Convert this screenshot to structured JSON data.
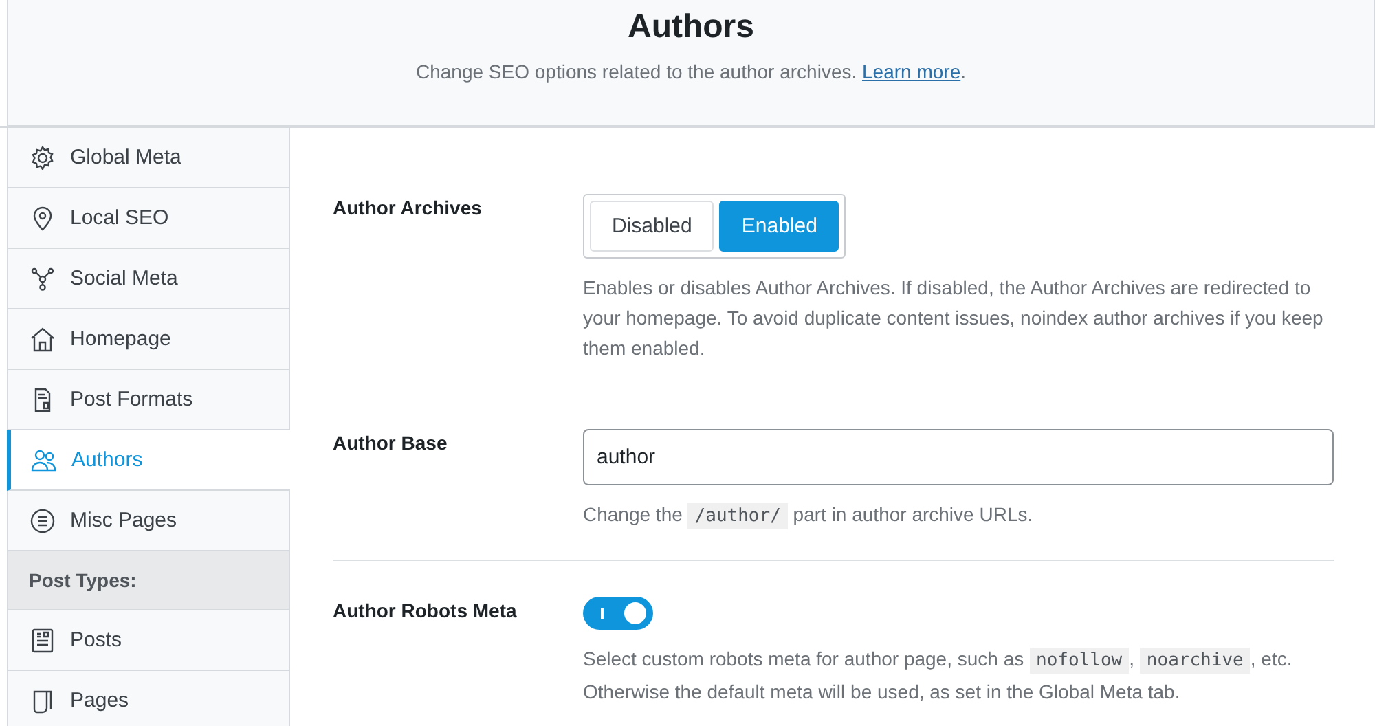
{
  "header": {
    "title": "Authors",
    "subtitle": "Change SEO options related to the author archives. ",
    "link": "Learn more",
    "after": "."
  },
  "sidebar": {
    "items": [
      {
        "kind": "nav",
        "label": "Global Meta",
        "selected": false
      },
      {
        "kind": "nav",
        "label": "Local SEO",
        "selected": false
      },
      {
        "kind": "nav",
        "label": "Social Meta",
        "selected": false
      },
      {
        "kind": "nav",
        "label": "Homepage",
        "selected": false
      },
      {
        "kind": "nav",
        "label": "Post Formats",
        "selected": false
      },
      {
        "kind": "nav",
        "label": "Authors",
        "selected": true
      },
      {
        "kind": "nav",
        "label": "Misc Pages",
        "selected": false
      },
      {
        "kind": "section",
        "label": "Post Types:"
      },
      {
        "kind": "nav",
        "label": "Posts",
        "selected": false
      },
      {
        "kind": "nav",
        "label": "Pages",
        "selected": false
      }
    ]
  },
  "settings": [
    {
      "kind": "segmented",
      "label": "Author Archives",
      "options": [
        {
          "label": "Disabled",
          "selected": false
        },
        {
          "label": "Enabled",
          "selected": true
        }
      ],
      "description": [
        {
          "kind": "text",
          "text": "Enables or disables Author Archives. If disabled, the Author Archives are redirected to your homepage. To avoid duplicate content issues, noindex author archives if you keep them enabled."
        }
      ]
    },
    {
      "kind": "input",
      "label": "Author Base",
      "value": "author",
      "description": [
        {
          "kind": "text",
          "text": "Change the "
        },
        {
          "kind": "code",
          "text": "/author/"
        },
        {
          "kind": "text",
          "text": " part in author archive URLs."
        }
      ]
    },
    {
      "kind": "toggle",
      "label": "Author Robots Meta",
      "on": true,
      "description": [
        {
          "kind": "text",
          "text": "Select custom robots meta for author page, such as "
        },
        {
          "kind": "code",
          "text": "nofollow"
        },
        {
          "kind": "text",
          "text": ", "
        },
        {
          "kind": "code",
          "text": "noarchive"
        },
        {
          "kind": "text",
          "text": ", etc. Otherwise the default meta will be used, as set in the Global Meta tab."
        }
      ]
    }
  ]
}
